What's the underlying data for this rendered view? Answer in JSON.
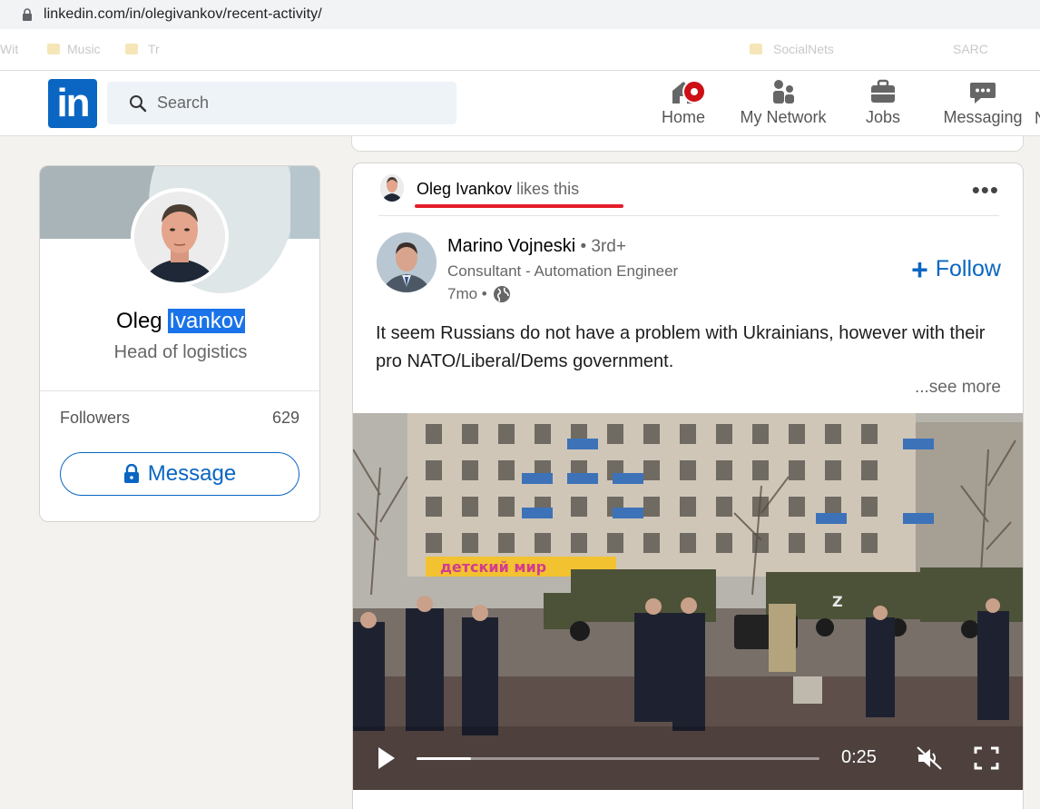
{
  "browser": {
    "url": "linkedin.com/in/olegivankov/recent-activity/",
    "bookmarks": [
      "Wit",
      "Music",
      "Tr",
      "SocialNets",
      "SARC"
    ]
  },
  "nav": {
    "logo": "in",
    "search_placeholder": "Search",
    "items": [
      {
        "label": "Home",
        "icon": "home-icon"
      },
      {
        "label": "My Network",
        "icon": "network-icon"
      },
      {
        "label": "Jobs",
        "icon": "briefcase-icon"
      },
      {
        "label": "Messaging",
        "icon": "messaging-icon"
      }
    ],
    "cutoff_label": "N"
  },
  "profile": {
    "first_name": "Oleg",
    "last_name": "Ivankov",
    "headline": "Head of logistics",
    "followers_label": "Followers",
    "followers_count": "629",
    "message_label": "Message"
  },
  "post": {
    "liker_name": "Oleg Ivankov",
    "liker_action": " likes this",
    "author_name": "Marino Vojneski",
    "author_degree": " • 3rd+",
    "author_headline": "Consultant - Automation Engineer",
    "time_ago": "7mo •",
    "follow_label": "Follow",
    "text": "It seem Russians do not have a problem with Ukrainians, however with their pro NATO/Liberal/Dems government.",
    "see_more": "...see more",
    "video": {
      "time": "0:25",
      "progress": 0.135,
      "shop_sign": "детский мир"
    }
  },
  "colors": {
    "linkedin_blue": "#0a66c2",
    "highlight": "#1a73e8",
    "underline_red": "#e41e2a"
  }
}
